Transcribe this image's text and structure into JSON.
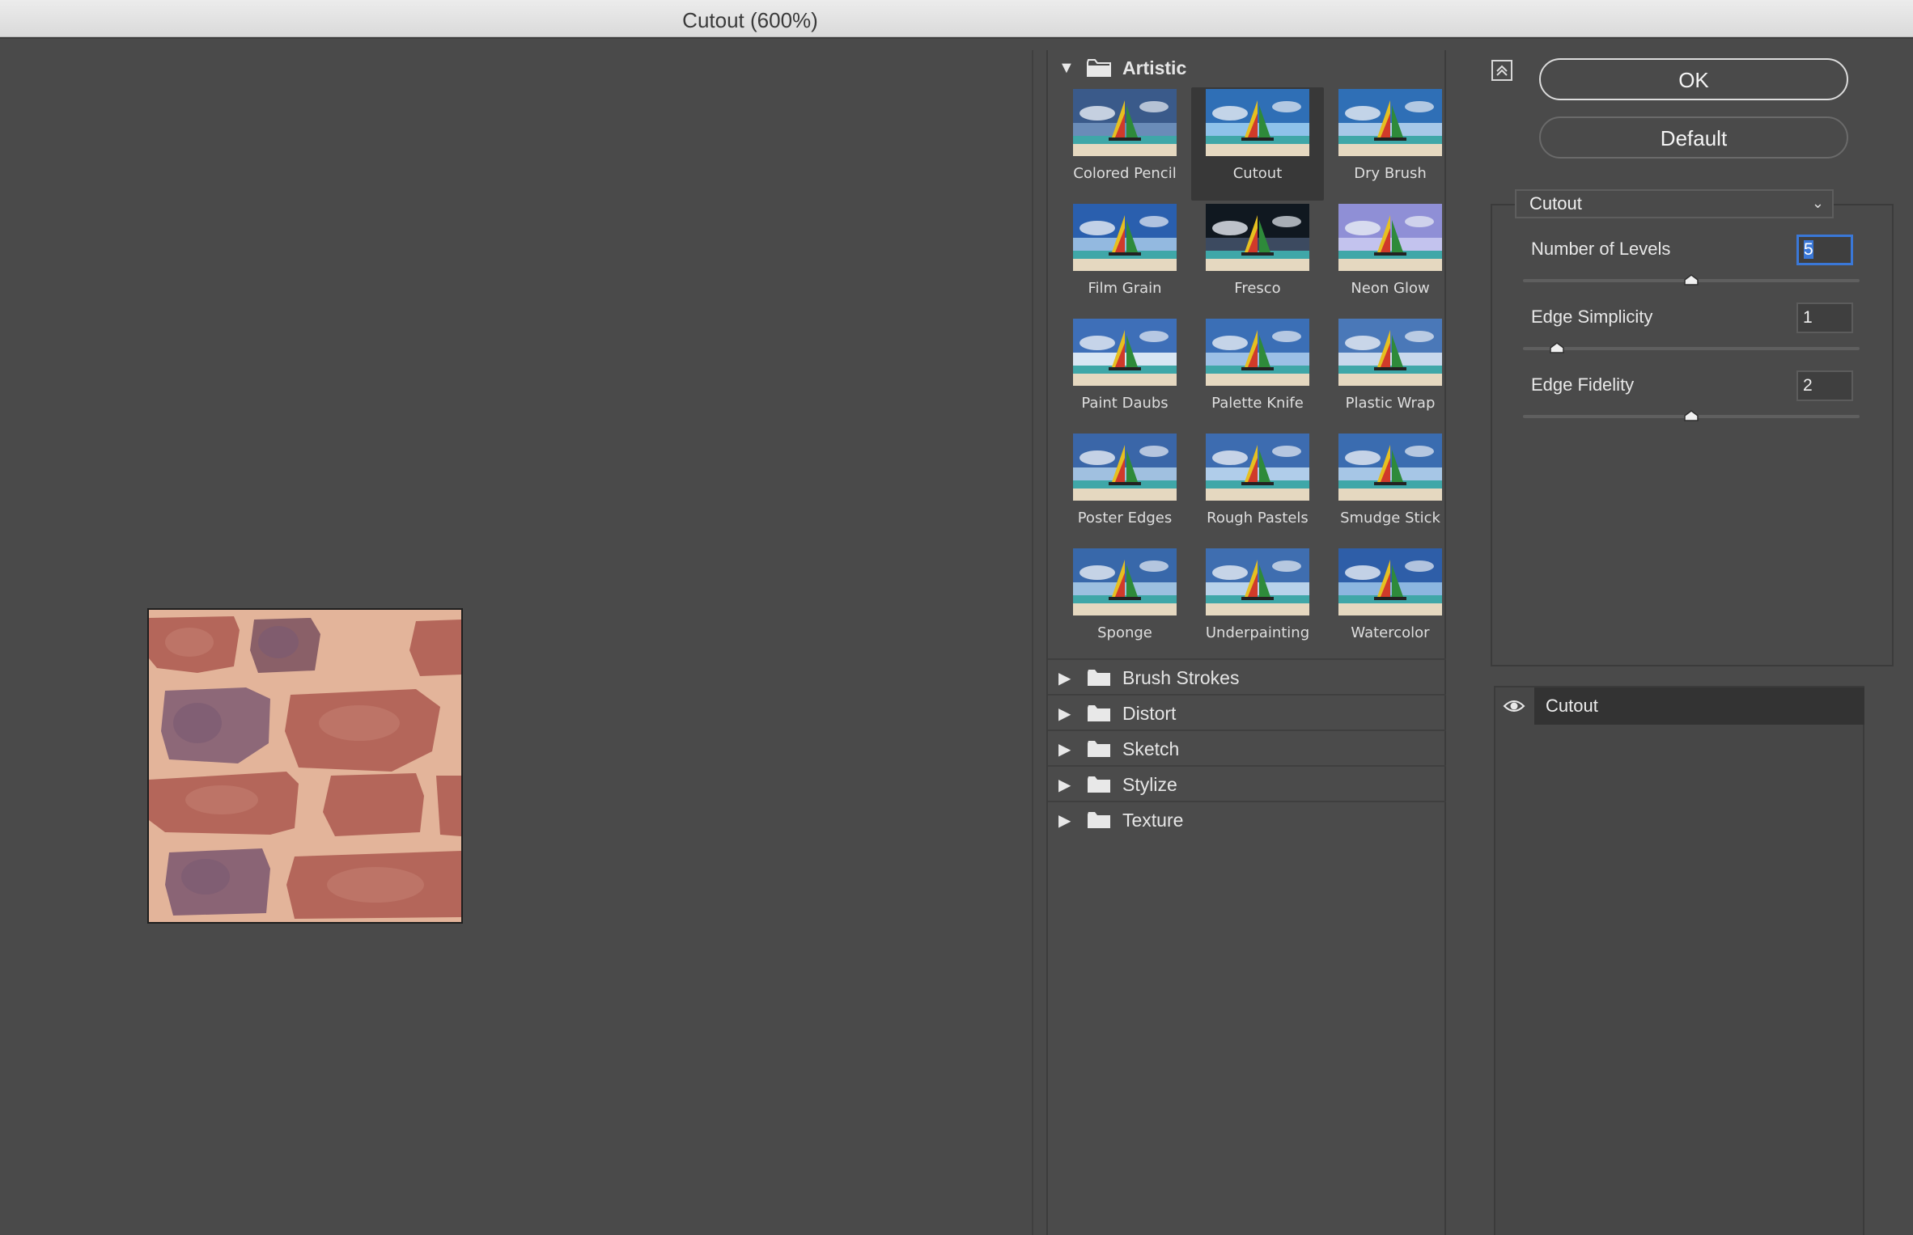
{
  "window": {
    "title": "Cutout (600%)"
  },
  "gallery": {
    "open_group": "Artistic",
    "filters": [
      "Colored Pencil",
      "Cutout",
      "Dry Brush",
      "Film Grain",
      "Fresco",
      "Neon Glow",
      "Paint Daubs",
      "Palette Knife",
      "Plastic Wrap",
      "Poster Edges",
      "Rough Pastels",
      "Smudge Stick",
      "Sponge",
      "Underpainting",
      "Watercolor"
    ],
    "selected_filter": "Cutout",
    "collapsed_groups": [
      "Brush Strokes",
      "Distort",
      "Sketch",
      "Stylize",
      "Texture"
    ]
  },
  "buttons": {
    "ok": "OK",
    "default": "Default"
  },
  "settings": {
    "filter_select": "Cutout",
    "params": [
      {
        "label": "Number of Levels",
        "value": "5",
        "slider_fraction": 0.5
      },
      {
        "label": "Edge Simplicity",
        "value": "1",
        "slider_fraction": 0.1
      },
      {
        "label": "Edge Fidelity",
        "value": "2",
        "slider_fraction": 0.5
      }
    ]
  },
  "layers": [
    {
      "name": "Cutout",
      "visible": true
    }
  ],
  "icons": {
    "group_open": "triangle-down-icon",
    "group_closed": "triangle-right-icon",
    "folder": "folder-icon",
    "eye": "eye-icon",
    "collapse": "collapse-panel-icon",
    "dropdown": "chevron-down-icon"
  },
  "colors": {
    "focus": "#3a78d8",
    "panel": "#4a4a4a",
    "selected_thumb": "#383838"
  }
}
